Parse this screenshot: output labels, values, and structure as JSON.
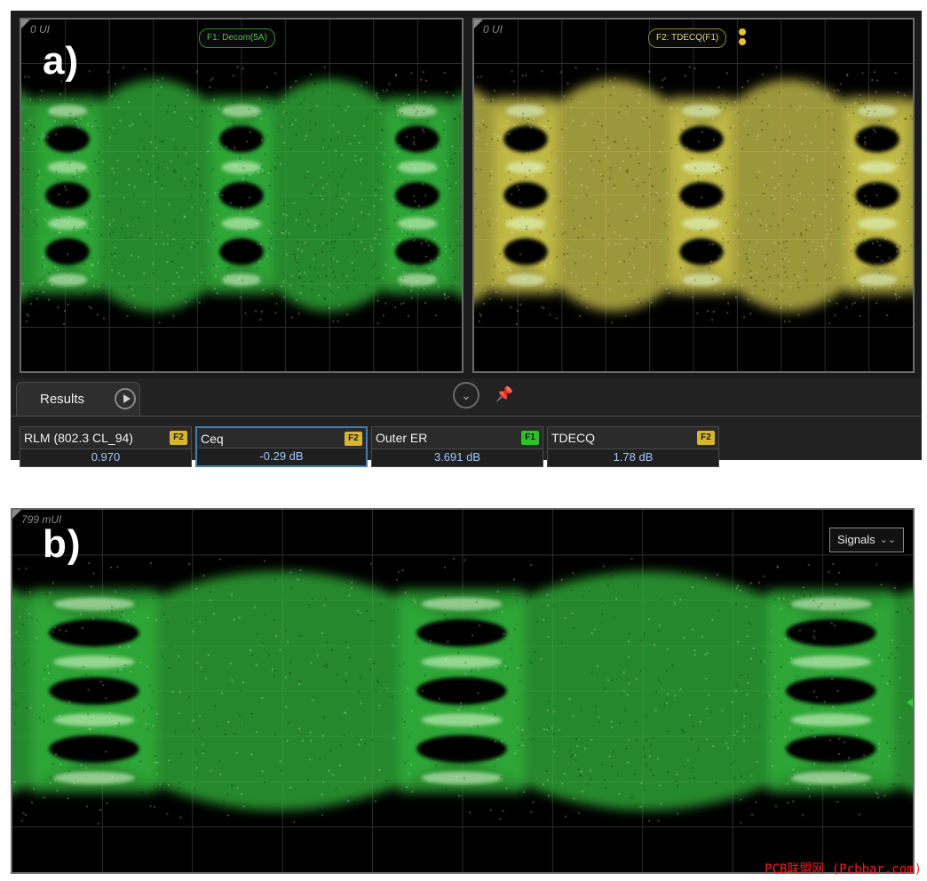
{
  "panel_a": {
    "letter": "a)",
    "left_screen": {
      "time_readout": "0 UI",
      "function_label": "F1: Decom(5A)",
      "trace_color": "#2fae3a"
    },
    "right_screen": {
      "time_readout": "0 UI",
      "function_label": "F2: TDECQ(F1)",
      "trace_color": "#c9c24a"
    },
    "results": {
      "tab_label": "Results",
      "measurements": [
        {
          "name": "RLM (802.3 CL_94)",
          "badge": "F2",
          "value": "0.970",
          "selected": false
        },
        {
          "name": "Ceq",
          "badge": "F2",
          "value": "-0.29 dB",
          "selected": true
        },
        {
          "name": "Outer ER",
          "badge": "F1",
          "value": "3.691 dB",
          "selected": false
        },
        {
          "name": "TDECQ",
          "badge": "F2",
          "value": "1.78 dB",
          "selected": false
        }
      ],
      "badge_colors": {
        "F1": "#2fbf2f",
        "F2": "#d8b530"
      }
    }
  },
  "panel_b": {
    "letter": "b)",
    "time_readout": "799 mUI",
    "signals_label": "Signals",
    "trace_color": "#2fae3a"
  },
  "watermark": "PCB联盟网 (Pcbbar.com)",
  "colors": {
    "selection_border": "#3f7fb4",
    "measurement_value": "#9ec7ff"
  }
}
